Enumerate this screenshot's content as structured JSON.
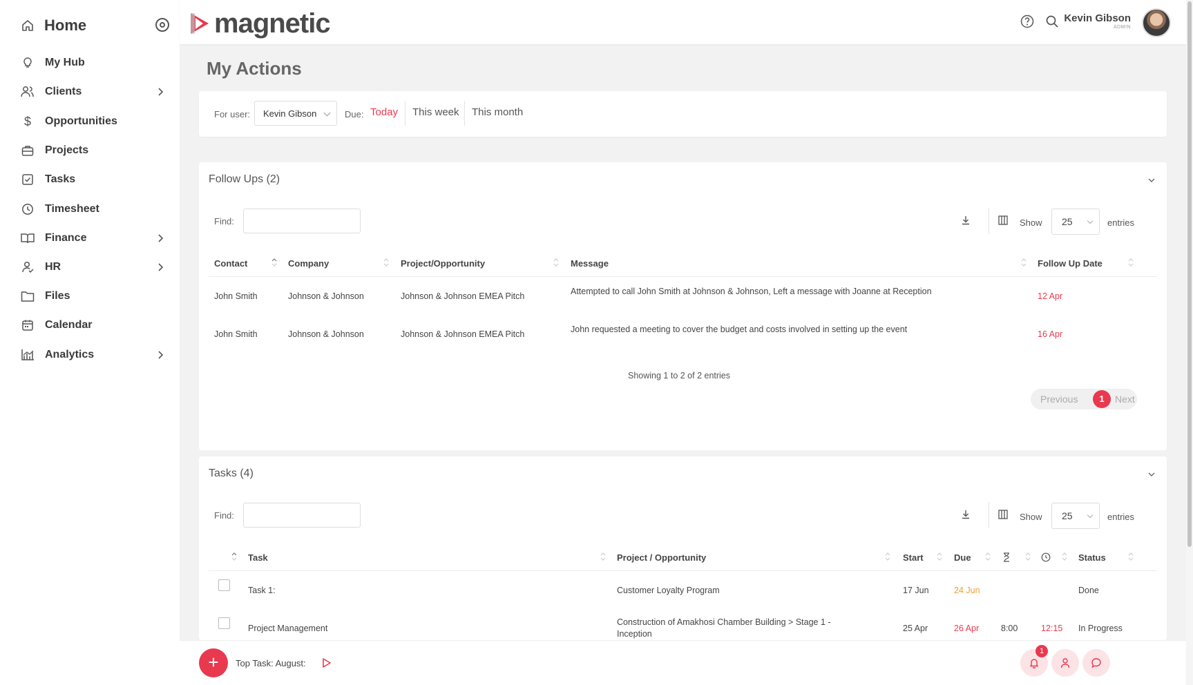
{
  "sidebar": {
    "home_label": "Home",
    "items": [
      {
        "label": "My Hub",
        "icon": "bulb-icon"
      },
      {
        "label": "Clients",
        "icon": "users-icon"
      },
      {
        "label": "Opportunities",
        "icon": "dollar-icon"
      },
      {
        "label": "Projects",
        "icon": "briefcase-icon"
      },
      {
        "label": "Tasks",
        "icon": "checkbox-icon"
      },
      {
        "label": "Timesheet",
        "icon": "clock-icon"
      },
      {
        "label": "Finance",
        "icon": "book-icon"
      },
      {
        "label": "HR",
        "icon": "person-icon"
      },
      {
        "label": "Files",
        "icon": "folder-icon"
      },
      {
        "label": "Calendar",
        "icon": "calendar-icon"
      },
      {
        "label": "Analytics",
        "icon": "chart-icon"
      }
    ]
  },
  "header": {
    "logo_text": "magnetic",
    "user_name": "Kevin Gibson",
    "user_role": "ADMIN"
  },
  "page": {
    "title": "My Actions"
  },
  "filters": {
    "for_user_label": "For user:",
    "user_value": "Kevin Gibson",
    "due_label": "Due:",
    "options": [
      "Today",
      "This week",
      "This month"
    ],
    "active": "Today"
  },
  "followups": {
    "title": "Follow Ups (2)",
    "find_label": "Find:",
    "show_label": "Show",
    "entries_value": "25",
    "entries_label": "entries",
    "columns": [
      "Contact",
      "Company",
      "Project/Opportunity",
      "Message",
      "Follow Up Date"
    ],
    "rows": [
      {
        "contact": "John Smith",
        "company": "Johnson & Johnson",
        "project": "Johnson & Johnson EMEA Pitch",
        "message": "Attempted to call John Smith at Johnson & Johnson, Left a message with Joanne at Reception",
        "date": "12 Apr"
      },
      {
        "contact": "John Smith",
        "company": "Johnson & Johnson",
        "project": "Johnson & Johnson EMEA Pitch",
        "message": "John requested a meeting to cover the budget and costs involved in setting up the event",
        "date": "16 Apr"
      }
    ],
    "showing": "Showing 1 to 2 of 2 entries",
    "pager": {
      "prev": "Previous",
      "page": "1",
      "next": "Next"
    }
  },
  "tasks": {
    "title": "Tasks (4)",
    "find_label": "Find:",
    "show_label": "Show",
    "entries_value": "25",
    "entries_label": "entries",
    "columns": [
      "Task",
      "Project / Opportunity",
      "Start",
      "Due",
      "Status"
    ],
    "rows": [
      {
        "task": "Task 1:",
        "project": "Customer Loyalty Program",
        "project2": "",
        "start": "17 Jun",
        "due": "24 Jun",
        "est": "",
        "time": "",
        "status": "Done"
      },
      {
        "task": "Project Management",
        "project": "Construction of Amakhosi Chamber Building > Stage 1 -",
        "project2": "Inception",
        "start": "25 Apr",
        "due": "26 Apr",
        "est": "8:00",
        "time": "12:15",
        "status": "In Progress"
      }
    ]
  },
  "bottom": {
    "fab": "+",
    "top_task": "Top Task: August:",
    "notif_count": "1"
  },
  "colors": {
    "accent": "#e8394f",
    "warning": "#f0a030"
  }
}
